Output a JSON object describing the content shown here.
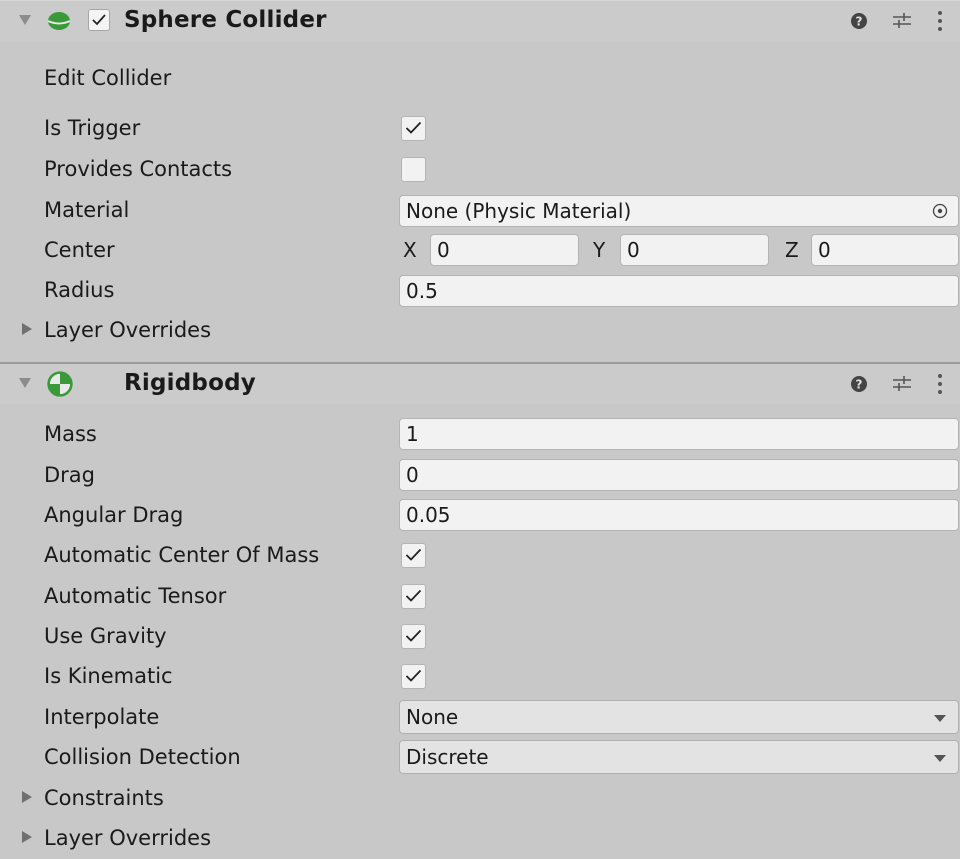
{
  "sphere_collider": {
    "title": "Sphere Collider",
    "enabled": true,
    "edit_collider_label": "Edit Collider",
    "is_trigger": {
      "label": "Is Trigger",
      "checked": true
    },
    "provides_contacts": {
      "label": "Provides Contacts",
      "checked": false
    },
    "material": {
      "label": "Material",
      "value": "None (Physic Material)"
    },
    "center": {
      "label": "Center",
      "x_label": "X",
      "x": "0",
      "y_label": "Y",
      "y": "0",
      "z_label": "Z",
      "z": "0"
    },
    "radius": {
      "label": "Radius",
      "value": "0.5"
    },
    "layer_overrides_label": "Layer Overrides"
  },
  "rigidbody": {
    "title": "Rigidbody",
    "mass": {
      "label": "Mass",
      "value": "1"
    },
    "drag": {
      "label": "Drag",
      "value": "0"
    },
    "angular_drag": {
      "label": "Angular Drag",
      "value": "0.05"
    },
    "automatic_center_of_mass": {
      "label": "Automatic Center Of Mass",
      "checked": true
    },
    "automatic_tensor": {
      "label": "Automatic Tensor",
      "checked": true
    },
    "use_gravity": {
      "label": "Use Gravity",
      "checked": true
    },
    "is_kinematic": {
      "label": "Is Kinematic",
      "checked": true
    },
    "interpolate": {
      "label": "Interpolate",
      "value": "None"
    },
    "collision_detection": {
      "label": "Collision Detection",
      "value": "Discrete"
    },
    "constraints_label": "Constraints",
    "layer_overrides_label": "Layer Overrides"
  },
  "icons": {
    "fold": "triangle-down-icon",
    "sphere_collider": "green-sphere-icon",
    "rigidbody": "rigidbody-icon",
    "help": "help-icon",
    "presets": "presets-sliders-icon",
    "menu": "kebab-menu-icon",
    "object_picker": "object-picker-icon"
  },
  "colors": {
    "collider_green": "#3a9a3a",
    "background": "#c8c8c8",
    "field": "#f2f2f2"
  }
}
